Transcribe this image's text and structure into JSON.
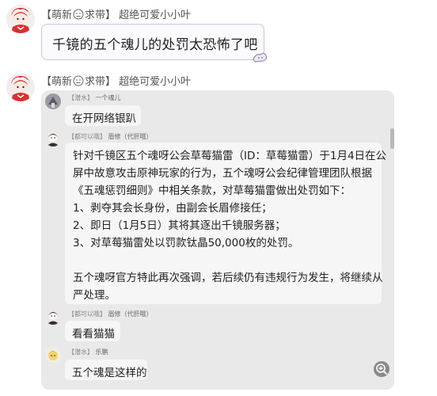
{
  "message1": {
    "sender_prefix": "【萌新",
    "sender_tag_suffix": "求带】",
    "sender_name": "超绝可爱小小叶",
    "text": "千镜的五个魂儿的处罚太恐怖了吧"
  },
  "message2": {
    "sender_prefix": "【萌新",
    "sender_tag_suffix": "求带】",
    "sender_name": "超绝可爱小小叶"
  },
  "forwarded": {
    "items": [
      {
        "badge": "【潜水】",
        "name": "一个魂儿",
        "text": "在开网络银趴"
      },
      {
        "badge": "【都可以哦】",
        "name": "眉修（代肝哦）",
        "lines": [
          "针对千镜区五个魂呀公会草莓猫雷（ID：草莓猫雷）于1月4日在公",
          "屏中故意攻击原神玩家的行为，五个魂呀公会纪律管理团队根据",
          "《五魂惩罚细则》中相关条款，对草莓猫雷做出处罚如下：",
          "1、剥夺其会长身份，由副会长眉修接任；",
          "2、即日（1月5日）其将其逐出千镜服务器；",
          "3、对草莓猫雷处以罚款钛晶50,000枚的处罚。",
          "",
          "五个魂呀官方特此再次强调，若后续仍有违规行为发生，将继续从",
          "严处理。"
        ]
      },
      {
        "badge": "【都可以哦】",
        "name": "眉修（代肝哦）",
        "text": "看看猫猫"
      },
      {
        "badge": "【潜水】",
        "name": "乐鹏",
        "text": "五个魂是这样的"
      }
    ]
  },
  "icons": {
    "emoji_face": "neutral-face-icon",
    "zoom": "zoom-in-icon"
  }
}
